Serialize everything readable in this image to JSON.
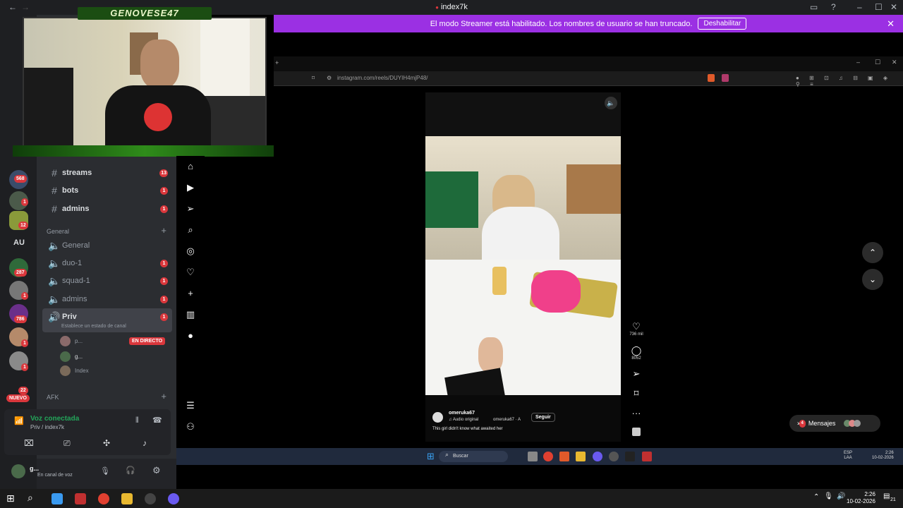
{
  "window": {
    "title": "index7k"
  },
  "banner": {
    "message": "El modo Streamer está habilitado. Los nombres de usuario se han truncado.",
    "button_label": "Deshabilitar"
  },
  "webcam": {
    "streamer_name": "GENOVESE47"
  },
  "servers": {
    "badges": [
      "568",
      "1",
      "12",
      "287",
      "1",
      "786",
      "1",
      "1",
      "22"
    ],
    "text_label": "AU",
    "new_label": "NUEVO"
  },
  "channels": {
    "text_channels": [
      {
        "name": "streams",
        "badge": "13"
      },
      {
        "name": "bots",
        "badge": "1"
      },
      {
        "name": "admins",
        "badge": "1"
      }
    ],
    "category_general": "General",
    "voice_channels": [
      {
        "name": "General",
        "badge": ""
      },
      {
        "name": "duo-1",
        "badge": "1"
      },
      {
        "name": "squad-1",
        "badge": "1"
      },
      {
        "name": "admins",
        "badge": "1"
      },
      {
        "name": "Priv",
        "badge": "1"
      }
    ],
    "priv_status": "Establece un estado de canal",
    "voice_users": [
      {
        "name": "p..."
      },
      {
        "name": "g..."
      },
      {
        "name": "Index"
      }
    ],
    "live_label": "EN DIRECTO",
    "category_afk": "AFK"
  },
  "voice_panel": {
    "status": "Voz conectada",
    "location": "Priv / index7k"
  },
  "user_panel": {
    "name": "g...",
    "status": "En canal de voz"
  },
  "browser": {
    "url": "instagram.com/reels/DUYIH4mjP48/"
  },
  "reel": {
    "username": "omeruka67",
    "audio": "Audio original",
    "mention": "omeruka67 · A",
    "follow_label": "Seguir",
    "caption": "This girl didn't know what awaited her",
    "likes": "736 mil",
    "comments": "8052"
  },
  "messages_button": {
    "label": "Mensajes",
    "badge": "4"
  },
  "inner_taskbar": {
    "search_placeholder": "Buscar",
    "lang_1": "ESP",
    "lang_2": "LAA",
    "time": "2:26",
    "date": "10-02-2026"
  },
  "taskbar": {
    "time": "2:26",
    "date": "10-02-2026",
    "notif_count": "21"
  },
  "colors": {
    "discord_dark": "#1e1f22",
    "discord_sidebar": "#2b2d31",
    "banner_purple": "#9b30e3",
    "badge_red": "#da373c",
    "voice_green": "#23a55a"
  }
}
